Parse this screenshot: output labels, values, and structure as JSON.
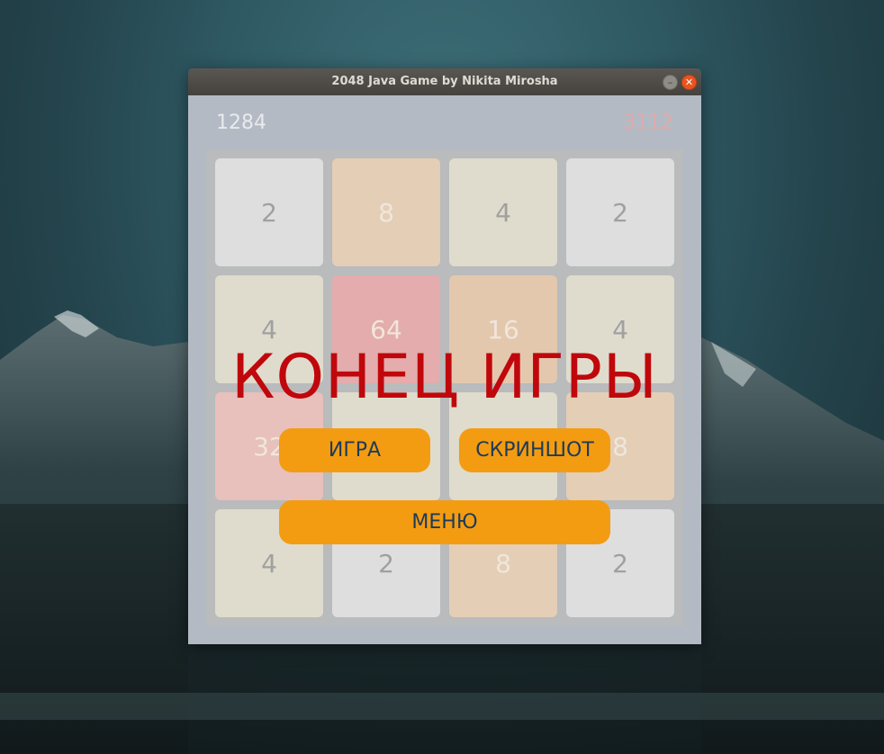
{
  "window": {
    "title": "2048 Java Game by Nikita Mirosha"
  },
  "header": {
    "score": "1284",
    "best": "3112"
  },
  "board": {
    "tiles": [
      {
        "value": "2",
        "bg": "#dedede",
        "fg": "#a0a0a0"
      },
      {
        "value": "8",
        "bg": "#e4ceb6",
        "fg": "#f0e6dc"
      },
      {
        "value": "4",
        "bg": "#dfdccd",
        "fg": "#a0a0a0"
      },
      {
        "value": "2",
        "bg": "#dedede",
        "fg": "#a0a0a0"
      },
      {
        "value": "4",
        "bg": "#dfdccd",
        "fg": "#a0a0a0"
      },
      {
        "value": "64",
        "bg": "#e4acac",
        "fg": "#f0e6dc"
      },
      {
        "value": "16",
        "bg": "#e4c8ad",
        "fg": "#f0e6dc"
      },
      {
        "value": "4",
        "bg": "#dfdccd",
        "fg": "#a0a0a0"
      },
      {
        "value": "32",
        "bg": "#e8c0bc",
        "fg": "#f0e6dc"
      },
      {
        "value": "",
        "bg": "#dfdccd",
        "fg": "#a0a0a0"
      },
      {
        "value": "",
        "bg": "#dfdccd",
        "fg": "#a0a0a0"
      },
      {
        "value": "8",
        "bg": "#e4ceb6",
        "fg": "#f0e6dc"
      },
      {
        "value": "4",
        "bg": "#dfdccd",
        "fg": "#a0a0a0"
      },
      {
        "value": "2",
        "bg": "#dedede",
        "fg": "#a0a0a0"
      },
      {
        "value": "8",
        "bg": "#e4ceb6",
        "fg": "#f0e6dc"
      },
      {
        "value": "2",
        "bg": "#dedede",
        "fg": "#a0a0a0"
      }
    ]
  },
  "overlay": {
    "game_over": "КОНЕЦ ИГРЫ"
  },
  "buttons": {
    "new_game": "ИГРА",
    "screenshot": "СКРИНШОТ",
    "menu": "МЕНЮ"
  },
  "colors": {
    "accent": "#f39c12",
    "game_over": "#c0070c",
    "button_text": "#1e3b58"
  }
}
